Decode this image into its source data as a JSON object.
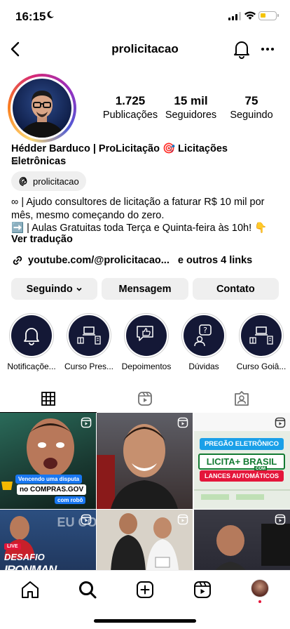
{
  "status_bar": {
    "time": "16:15"
  },
  "header": {
    "username": "prolicitacao"
  },
  "profile": {
    "stats": [
      {
        "value": "1.725",
        "label": "Publicações"
      },
      {
        "value": "15 mil",
        "label": "Seguidores"
      },
      {
        "value": "75",
        "label": "Seguindo"
      }
    ],
    "display_name": "Hédder Barduco | ProLicitação 🎯 Licitações Eletrônicas",
    "name_suffix": "∞",
    "threads_handle": "prolicitacao",
    "bio_lines": [
      "∞ | Ajudo consultores de licitação a faturar R$ 10 mil por",
      "mês, mesmo começando do zero.",
      "➡️ | Aulas Gratuitas toda Terça e Quinta-feira às 10h! 👇"
    ],
    "translate_label": "Ver tradução",
    "link_text": "youtube.com/@prolicitacao...",
    "more_links": "e outros 4 links"
  },
  "actions": {
    "following": "Seguindo",
    "message": "Mensagem",
    "contact": "Contato"
  },
  "highlights": [
    {
      "label": "Notificaçõe...",
      "icon": "bell-icon"
    },
    {
      "label": "Curso Pres...",
      "icon": "laptop-icon"
    },
    {
      "label": "Depoimentos",
      "icon": "thumbs-up-icon"
    },
    {
      "label": "Dúvidas",
      "icon": "question-icon"
    },
    {
      "label": "Curso Goiâ...",
      "icon": "laptop-icon"
    }
  ],
  "posts": [
    {
      "overlay_line1": "Vencendo uma disputa",
      "overlay_line2": "no COMPRAS.GOV",
      "overlay_line3": "com robô"
    },
    {
      "overlay_line1": ""
    },
    {
      "overlay_line1": "PREGÃO ELETRÔNICO",
      "overlay_line2": "LICITA+ BRASIL",
      "overlay_line3": "COM",
      "overlay_line4": "LANCES AUTOMÁTICOS"
    },
    {
      "badge": "LIVE",
      "overlay_line1": "DESAFIO",
      "overlay_line2": "IRONMAN"
    },
    {
      "overlay_line1": ""
    },
    {
      "overlay_line1": ""
    }
  ],
  "colors": {
    "highlight_bg": "#141836",
    "brand_blue": "#1877f2",
    "live_red": "#e4163a"
  }
}
